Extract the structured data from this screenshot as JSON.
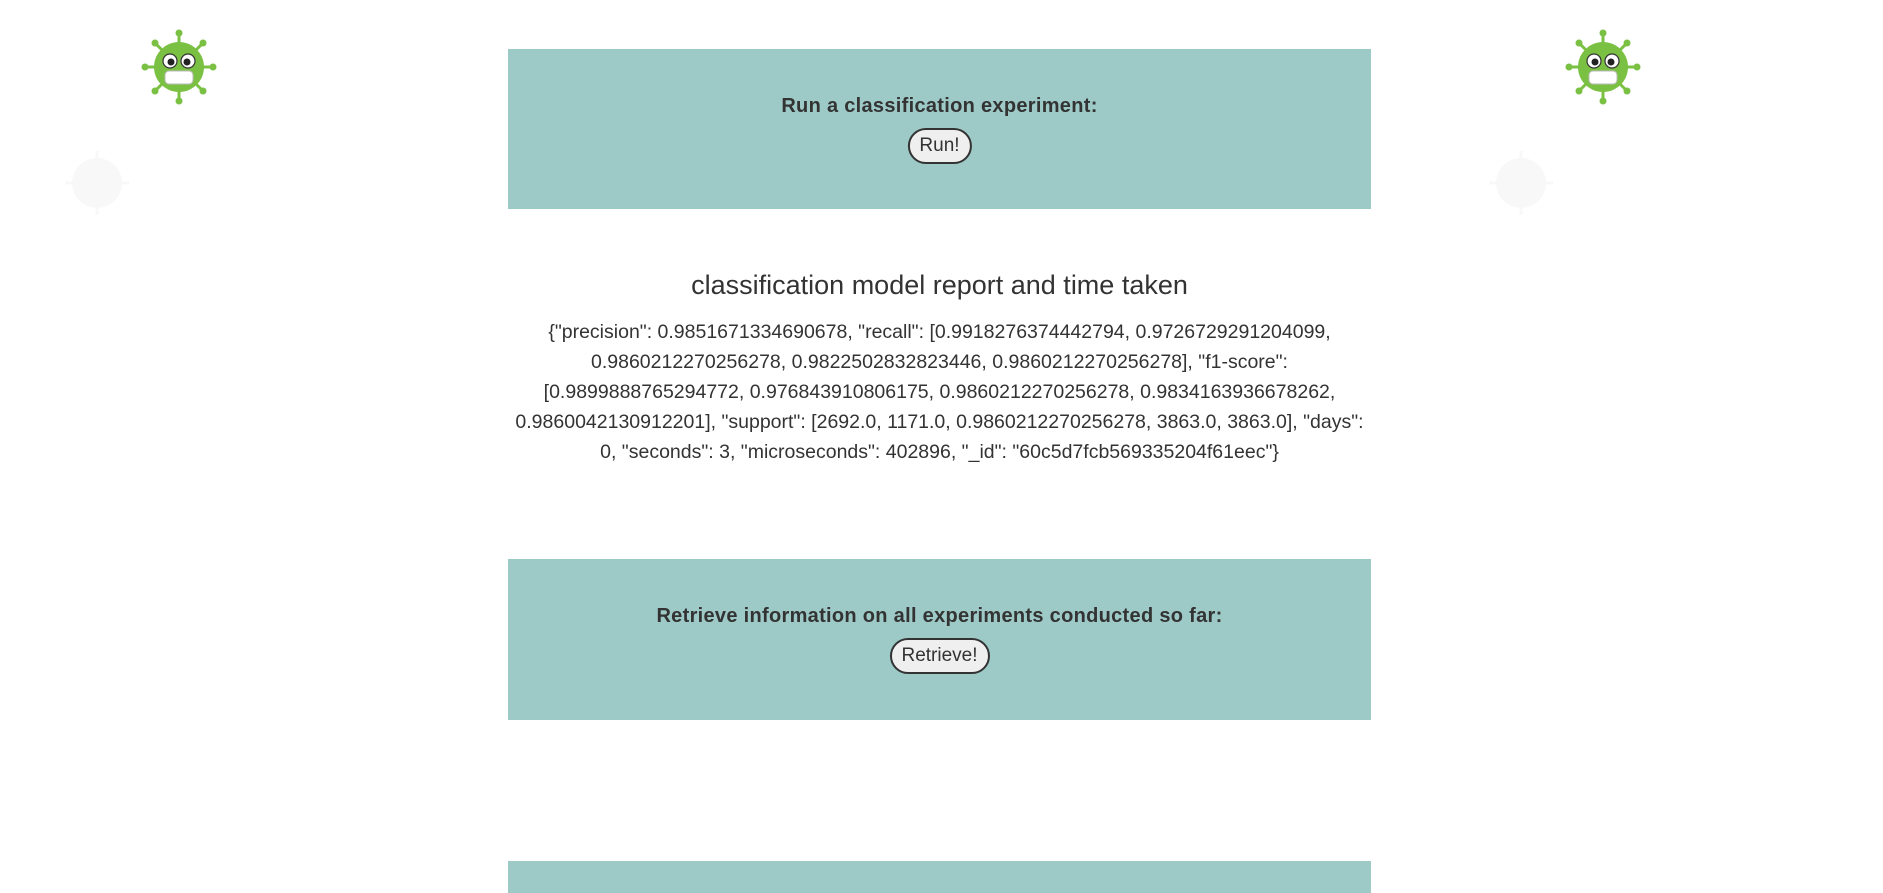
{
  "run_panel": {
    "heading": "Run a classification experiment:",
    "button_label": "Run!"
  },
  "report": {
    "title": "classification model report and time taken",
    "body": "{\"precision\": 0.9851671334690678, \"recall\": [0.9918276374442794, 0.9726729291204099, 0.9860212270256278, 0.9822502832823446, 0.9860212270256278], \"f1-score\": [0.9899888765294772, 0.976843910806175, 0.9860212270256278, 0.9834163936678262, 0.9860042130912201], \"support\": [2692.0, 1171.0, 0.9860212270256278, 3863.0, 3863.0], \"days\": 0, \"seconds\": 3, \"microseconds\": 402896, \"_id\": \"60c5d7fcb569335204f61eec\"}"
  },
  "retrieve_panel": {
    "heading": "Retrieve information on all experiments conducted so far:",
    "button_label": "Retrieve!"
  },
  "decorations": {
    "virus_icon_color": "#7ac143",
    "panel_color": "#9dc9c7"
  }
}
